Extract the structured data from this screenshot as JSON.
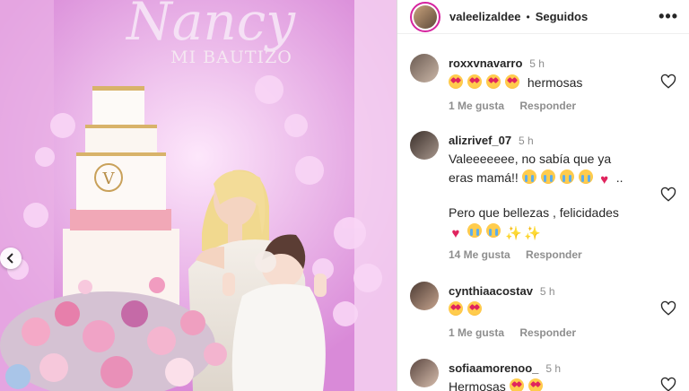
{
  "post": {
    "username": "valeelizaldee",
    "separator": "•",
    "follow_status": "Seguidos",
    "more": "•••"
  },
  "photo": {
    "sign_title": "Nancy",
    "sign_subtitle": "MI BAUTIZO",
    "cake_monogram": "V"
  },
  "comments": [
    {
      "username": "roxxvnavarro",
      "time": "5 h",
      "line1_text": "hermosas",
      "likes": "1 Me gusta",
      "reply": "Responder"
    },
    {
      "username": "alizrivef_07",
      "time": "5 h",
      "line1_text": "Valeeeeeee, no sabía que ya",
      "line2_text": "eras mamá!!",
      "line2_suffix": "..",
      "line3_text": "Pero que bellezas , felicidades",
      "likes": "14 Me gusta",
      "reply": "Responder"
    },
    {
      "username": "cynthiaacostav",
      "time": "5 h",
      "likes": "1 Me gusta",
      "reply": "Responder"
    },
    {
      "username": "sofiaamorenoo_",
      "time": "5 h",
      "line1_text": "Hermosas"
    }
  ],
  "icons": {
    "nav": "chevron-left-icon",
    "like": "heart-outline-icon"
  },
  "colors": {
    "story_ring": "#d6249f",
    "muted": "#8e8e8e",
    "text": "#262626"
  }
}
